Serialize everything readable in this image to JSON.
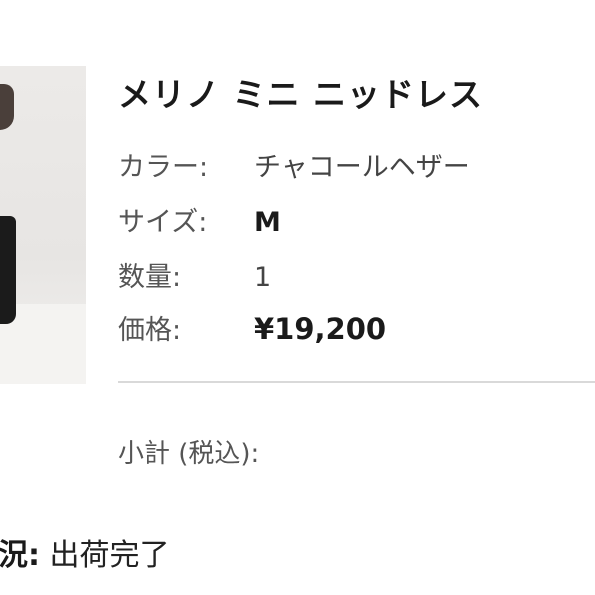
{
  "product": {
    "title": "メリノ ミニ ニッドレス",
    "color_label": "カラー:",
    "color_value": "チャコールヘザー",
    "size_label": "サイズ:",
    "size_value": "M",
    "quantity_label": "数量:",
    "quantity_value": "1",
    "price_label": "価格:",
    "price_value": "¥19,200"
  },
  "summary": {
    "subtotal_label": "小計 (税込):"
  },
  "order": {
    "status_label": "況:",
    "status_value": "出荷完了"
  }
}
